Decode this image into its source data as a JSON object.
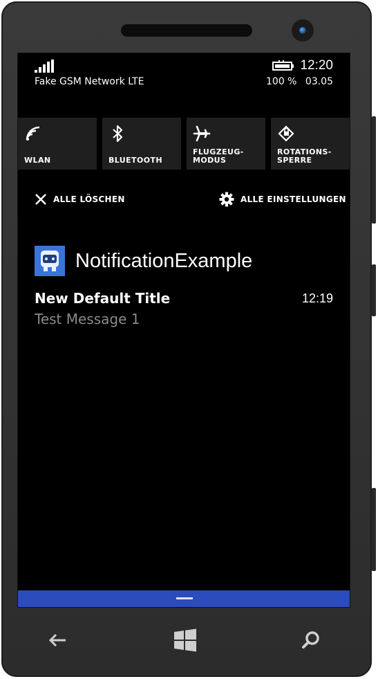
{
  "status": {
    "carrier": "Fake GSM Network LTE",
    "time": "12:20",
    "battery_percent": "100 %",
    "date": "03.05",
    "signal_bars": 5
  },
  "quick_actions": [
    {
      "label": "WLAN",
      "icon": "wifi-icon"
    },
    {
      "label": "BLUETOOTH",
      "icon": "bluetooth-icon"
    },
    {
      "label": "FLUGZEUG-\nMODUS",
      "icon": "airplane-icon"
    },
    {
      "label": "ROTATIONS-\nSPERRE",
      "icon": "rotation-lock-icon"
    }
  ],
  "actions": {
    "clear_all": "ALLE LÖSCHEN",
    "all_settings": "ALLE EINSTELLUNGEN"
  },
  "app": {
    "name": "NotificationExample",
    "icon": "app-icon"
  },
  "notification": {
    "title": "New Default Title",
    "message": "Test Message 1",
    "time": "12:19"
  },
  "nav": {
    "back_icon": "back-arrow-icon",
    "start_icon": "windows-logo-icon",
    "search_icon": "search-icon"
  },
  "colors": {
    "accent": "#2b4cbc",
    "tile_bg": "#1f1f1f",
    "app_icon_bg": "#3a74d8",
    "secondary_text": "#8a8a8a"
  }
}
